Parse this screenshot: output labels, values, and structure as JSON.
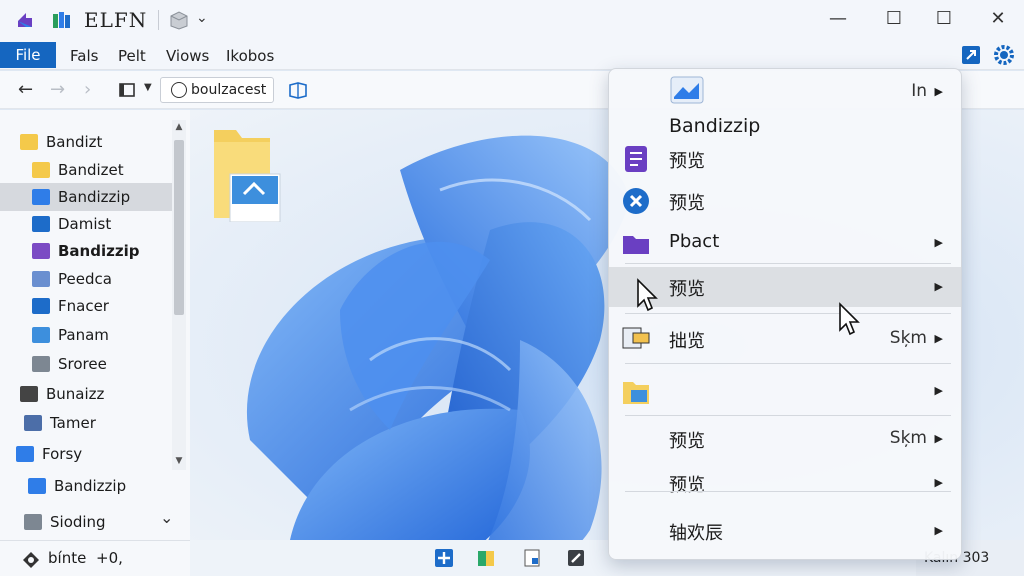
{
  "window": {
    "title": "ELFN",
    "controls": {
      "minimize": "—",
      "maximize": "☐",
      "close": "✕"
    }
  },
  "menubar": {
    "items": [
      "File",
      "Fals",
      "Pelt",
      "Viows",
      "Ikobos"
    ]
  },
  "toolbar": {
    "address": "boulzacest"
  },
  "sidebar": {
    "items": [
      {
        "label": "Bandizt",
        "icon": "folder-icon"
      },
      {
        "label": "Bandizet",
        "icon": "book-folder-icon"
      },
      {
        "label": "Bandizzip",
        "icon": "grid-icon"
      },
      {
        "label": "Damist",
        "icon": "pin-icon"
      },
      {
        "label": "Bandizzip",
        "icon": "purple-doc-icon"
      },
      {
        "label": "Peedca",
        "icon": "doc-icon"
      },
      {
        "label": "Fnacer",
        "icon": "blue-folder-icon"
      },
      {
        "label": "Panam",
        "icon": "picture-icon"
      },
      {
        "label": "Sroree",
        "icon": "grid-doc-icon"
      },
      {
        "label": "Bunaizz",
        "icon": "play-icon"
      },
      {
        "label": "Tamer",
        "icon": "window-icon"
      },
      {
        "label": "Forsy",
        "icon": "network-icon"
      },
      {
        "label": "Bandizzip",
        "icon": "drive-icon"
      },
      {
        "label": "Sioding",
        "icon": "computer-icon"
      }
    ],
    "footer": {
      "label": "bínte",
      "extra": "+0,"
    }
  },
  "context_menu": {
    "header": {
      "title": "Bandizzip",
      "shortcut": "In"
    },
    "items": [
      {
        "label": "预览",
        "right": "",
        "submenu": false
      },
      {
        "label": "预览",
        "right": "",
        "submenu": false
      },
      {
        "label": "Pbact",
        "right": "",
        "submenu": true
      },
      {
        "label": "预览",
        "right": "",
        "submenu": true
      },
      {
        "label": "拙览",
        "right": "Sķm",
        "submenu": true
      },
      {
        "label": "",
        "right": "",
        "submenu": true
      },
      {
        "label": "预览",
        "right": "Sķm",
        "submenu": true
      },
      {
        "label": "预览",
        "right": "",
        "submenu": true
      },
      {
        "label": "轴欢辰",
        "right": "",
        "submenu": true
      }
    ]
  },
  "taskbar": {
    "tray_text": "Kalın 303"
  },
  "colors": {
    "accent": "#1566c0",
    "bloom": "#2f7de8"
  }
}
